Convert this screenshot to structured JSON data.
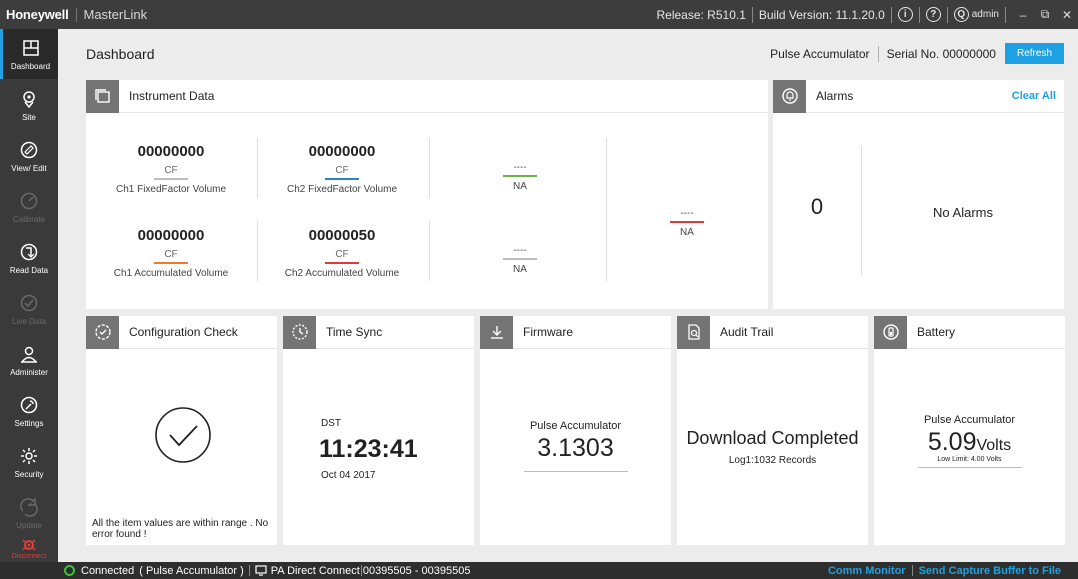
{
  "titlebar": {
    "brand": "Honeywell",
    "app": "MasterLink",
    "release": "Release: R510.1",
    "build": "Build Version: 11.1.20.0",
    "user": "admin"
  },
  "sidebar": {
    "items": [
      {
        "label": "Dashboard",
        "icon": "dashboard-icon"
      },
      {
        "label": "Site",
        "icon": "location-pin-icon"
      },
      {
        "label": "View/ Edit",
        "icon": "view-edit-icon"
      },
      {
        "label": "Calibrate",
        "icon": "calibrate-icon"
      },
      {
        "label": "Read Data",
        "icon": "read-data-icon"
      },
      {
        "label": "Live Data",
        "icon": "live-data-icon"
      },
      {
        "label": "Administer",
        "icon": "administer-icon"
      },
      {
        "label": "Settings",
        "icon": "wrench-icon"
      },
      {
        "label": "Security",
        "icon": "security-icon"
      },
      {
        "label": "Update",
        "icon": "update-icon"
      }
    ],
    "disconnect": "Disconnect"
  },
  "header": {
    "title": "Dashboard",
    "device": "Pulse Accumulator",
    "serial": "Serial No. 00000000",
    "refresh": "Refresh"
  },
  "instrument": {
    "title": "Instrument Data",
    "ch1_ff": {
      "value": "00000000",
      "unit": "CF",
      "label": "Ch1 FixedFactor Volume"
    },
    "ch2_ff": {
      "value": "00000000",
      "unit": "CF",
      "label": "Ch2 FixedFactor Volume"
    },
    "ch1_acc": {
      "value": "00000000",
      "unit": "CF",
      "label": "Ch1 Accumulated Volume"
    },
    "ch2_acc": {
      "value": "00000050",
      "unit": "CF",
      "label": "Ch2 Accumulated Volume"
    },
    "c3_top": {
      "dash": "----",
      "label": "NA"
    },
    "c3_bot": {
      "dash": "----",
      "label": "NA"
    },
    "c4": {
      "dash": "----",
      "label": "NA"
    }
  },
  "alarms": {
    "title": "Alarms",
    "clear": "Clear All",
    "count": "0",
    "text": "No Alarms"
  },
  "config": {
    "title": "Configuration Check",
    "message": "All the item values are within range . No error found !"
  },
  "timesync": {
    "title": "Time Sync",
    "dst": "DST",
    "time": "11:23:41",
    "date": "Oct 04 2017"
  },
  "firmware": {
    "title": "Firmware",
    "device": "Pulse Accumulator",
    "version": "3.1303"
  },
  "audit": {
    "title": "Audit Trail",
    "status": "Download Completed",
    "records": "Log1:1032 Records"
  },
  "battery": {
    "title": "Battery",
    "device": "Pulse Accumulator",
    "value": "5.09",
    "unit": "Volts",
    "limit": "Low Limit: 4.00 Volts"
  },
  "status": {
    "connected": "Connected",
    "device": "( Pulse Accumulator )",
    "conn_type": "PA Direct Connect",
    "port": "00395505 - 00395505",
    "comm": "Comm Monitor",
    "capture": "Send Capture Buffer to File"
  },
  "colors": {
    "accent": "#1ea1e2",
    "bar_ch1_ff": "#bdbdbd",
    "bar_ch2_ff": "#2f7fc1",
    "bar_ch1_acc": "#f07a2b",
    "bar_ch2_acc": "#e03a3a",
    "bar_c3_top": "#6bb34a",
    "bar_c3_bot": "#bdbdbd",
    "bar_c4": "#e03a3a"
  }
}
